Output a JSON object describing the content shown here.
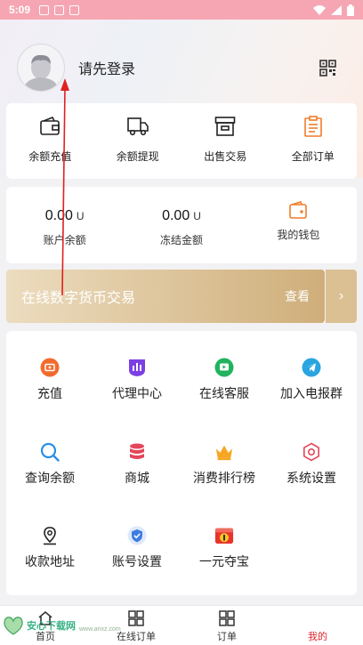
{
  "status_bar": {
    "time": "5:09"
  },
  "profile": {
    "login_prompt": "请先登录"
  },
  "quick_actions": [
    {
      "label": "余额充值",
      "icon": "wallet-icon"
    },
    {
      "label": "余额提现",
      "icon": "truck-icon"
    },
    {
      "label": "出售交易",
      "icon": "archive-box-icon"
    },
    {
      "label": "全部订单",
      "icon": "clipboard-icon"
    }
  ],
  "wallet": {
    "account_balance": {
      "value": "0.00",
      "unit": "U",
      "label": "账户余额"
    },
    "frozen_amount": {
      "value": "0.00",
      "unit": "U",
      "label": "冻结金额"
    },
    "my_wallet": {
      "label": "我的钱包",
      "icon": "wallet-icon"
    }
  },
  "banner": {
    "title": "在线数字货币交易",
    "more": "查看",
    "arrow": "›"
  },
  "services": [
    {
      "label": "充值",
      "icon": "recharge-icon",
      "color": "#f26b2e"
    },
    {
      "label": "代理中心",
      "icon": "bar-chart-icon",
      "color": "#7b3fe4"
    },
    {
      "label": "在线客服",
      "icon": "play-icon",
      "color": "#22b35e"
    },
    {
      "label": "加入电报群",
      "icon": "telegram-icon",
      "color": "#2aa5e0"
    },
    {
      "label": "查询余额",
      "icon": "search-icon",
      "color": "#2b8fe6"
    },
    {
      "label": "商城",
      "icon": "database-icon",
      "color": "#e4465a"
    },
    {
      "label": "消费排行榜",
      "icon": "crown-icon",
      "color": "#f5a623"
    },
    {
      "label": "系统设置",
      "icon": "gear-icon",
      "color": "#e4465a"
    },
    {
      "label": "收款地址",
      "icon": "location-pin-icon",
      "color": "#222222"
    },
    {
      "label": "账号设置",
      "icon": "shield-icon",
      "color": "#3d7de0"
    },
    {
      "label": "一元夺宝",
      "icon": "lottery-icon",
      "color": "#e8342f"
    }
  ],
  "tabbar": [
    {
      "label": "首页",
      "icon": "home-icon",
      "active": false
    },
    {
      "label": "在线订单",
      "icon": "grid-icon",
      "active": false
    },
    {
      "label": "订单",
      "icon": "grid-icon",
      "active": false
    },
    {
      "label": "我的",
      "icon": "user-icon",
      "active": true
    }
  ],
  "watermark": {
    "text": "安心下载网",
    "url": "www.anxz.com"
  },
  "colors": {
    "accent": "#e0262b",
    "status_bar": "#f6a6b3",
    "banner_gold": "#dcc399"
  }
}
